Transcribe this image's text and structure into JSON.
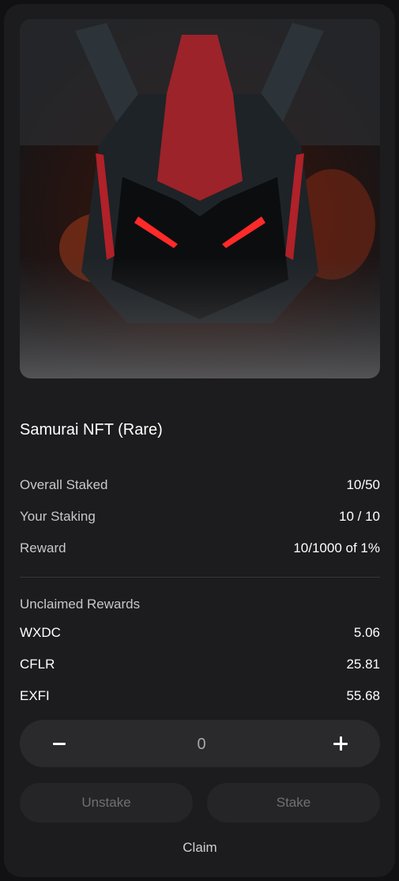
{
  "nft": {
    "title": "Samurai NFT (Rare)",
    "image_alt": "samurai-helmet-artwork"
  },
  "stats": [
    {
      "label": "Overall Staked",
      "value": "10/50"
    },
    {
      "label": "Your Staking",
      "value": "10 / 10"
    },
    {
      "label": "Reward",
      "value": "10/1000 of 1%"
    }
  ],
  "rewards": {
    "heading": "Unclaimed Rewards",
    "tokens": [
      {
        "symbol": "WXDC",
        "amount": "5.06"
      },
      {
        "symbol": "CFLR",
        "amount": "25.81"
      },
      {
        "symbol": "EXFI",
        "amount": "55.68"
      }
    ]
  },
  "stepper": {
    "value": "0"
  },
  "actions": {
    "unstake": "Unstake",
    "stake": "Stake",
    "claim": "Claim"
  },
  "colors": {
    "background": "#111113",
    "card": "#1c1c1e",
    "stepper": "#2a2a2d",
    "button": "#252527",
    "accent_red": "#d4202a"
  }
}
